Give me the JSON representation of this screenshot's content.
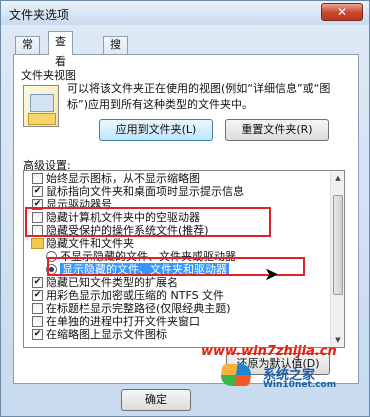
{
  "window": {
    "title": "文件夹选项",
    "close_icon": "✕"
  },
  "tabs": [
    {
      "label": "常规"
    },
    {
      "label": "查看"
    },
    {
      "label": "搜索"
    }
  ],
  "folder_view": {
    "group_title": "文件夹视图",
    "description": "可以将该文件夹正在使用的视图(例如“详细信息”或“图标”)应用到所有这种类型的文件夹中。",
    "apply_button": "应用到文件夹(L)",
    "reset_button": "重置文件夹(R)"
  },
  "advanced": {
    "label": "高级设置:",
    "items": [
      {
        "type": "checkbox",
        "checked": false,
        "label": "始终显示图标，从不显示缩略图"
      },
      {
        "type": "checkbox",
        "checked": true,
        "label": "鼠标指向文件夹和桌面项时显示提示信息"
      },
      {
        "type": "checkbox",
        "checked": true,
        "label": "显示驱动器号"
      },
      {
        "type": "checkbox",
        "checked": false,
        "label": "隐藏计算机文件夹中的空驱动器"
      },
      {
        "type": "checkbox",
        "checked": false,
        "label": "隐藏受保护的操作系统文件(推荐)"
      },
      {
        "type": "folder",
        "label": "隐藏文件和文件夹"
      },
      {
        "type": "radio",
        "checked": false,
        "label": "不显示隐藏的文件、文件夹或驱动器"
      },
      {
        "type": "radio",
        "checked": true,
        "label": "显示隐藏的文件、文件夹和驱动器",
        "selected": true
      },
      {
        "type": "checkbox",
        "checked": true,
        "label": "隐藏已知文件类型的扩展名"
      },
      {
        "type": "checkbox",
        "checked": true,
        "label": "用彩色显示加密或压缩的 NTFS 文件"
      },
      {
        "type": "checkbox",
        "checked": false,
        "label": "在标题栏显示完整路径(仅限经典主题)"
      },
      {
        "type": "checkbox",
        "checked": false,
        "label": "在单独的进程中打开文件夹窗口"
      },
      {
        "type": "checkbox",
        "checked": true,
        "label": "在缩略图上显示文件图标"
      }
    ],
    "check_mark": "✔",
    "scroll_up_icon": "▲",
    "scroll_down_icon": "▼"
  },
  "buttons": {
    "restore_default": "还原为默认值(D)",
    "ok": "确定"
  },
  "watermark": {
    "url": "www.win7zhijia.cn",
    "site": "系统之家",
    "site_en": "Win10net.com"
  },
  "cursor_icon": "➤",
  "colors": {
    "highlight": "#e0232b",
    "selection": "#3399ff"
  }
}
